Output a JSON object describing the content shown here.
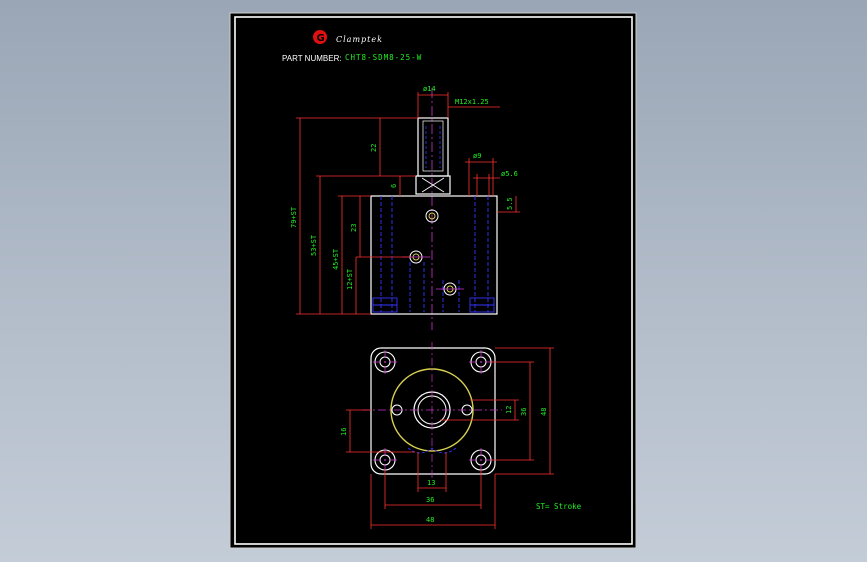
{
  "title_block": {
    "brand": "Clamptek",
    "part_number_label": "PART NUMBER:",
    "part_number_value": "CHT8-SDM8-25-W"
  },
  "front_view_dims": {
    "d_rod": "ø14",
    "thread": "M12x1.25",
    "h_22": "22",
    "h_79": "79+ST",
    "h_53": "53+ST",
    "h_45": "45+ST",
    "h_12": "12+ST",
    "h_23": "23",
    "h_6": "6",
    "d_9": "ø9",
    "d_56": "ø5.6",
    "h_55": "5.5"
  },
  "top_view_dims": {
    "v_12": "12",
    "v_36": "36",
    "v_48": "48",
    "v_16": "16",
    "h_13": "13",
    "h_36": "36",
    "h_48": "48"
  },
  "legend": {
    "stroke_note": "ST= Stroke"
  },
  "colors": {
    "paper": "#000000",
    "frame": "#ffffff",
    "part_outline": "#ffffff",
    "dimension": "#ff3030",
    "dim_text": "#22ee22",
    "center_line": "#cc33cc",
    "hidden_line": "#3333ff",
    "logo": "#e01010",
    "highlight": "#d8d050"
  }
}
